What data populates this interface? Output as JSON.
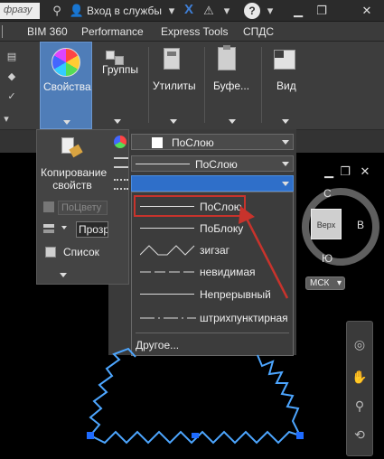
{
  "titlebar": {
    "search_text": "фразу",
    "signin_label": "Вход в службы",
    "icons": [
      "binoculars-icon",
      "user-icon",
      "x-icon",
      "triangle-icon",
      "help-icon"
    ],
    "window_buttons": [
      "minimize-icon",
      "restore-icon",
      "close-icon"
    ]
  },
  "tabs": [
    "BIM 360",
    "Performance",
    "Express Tools",
    "СПДС"
  ],
  "ribbon": {
    "properties_label": "Свойства",
    "groups_label": "Группы",
    "utilities_label": "Утилиты",
    "clipboard_label": "Буфе...",
    "view_label": "Вид"
  },
  "panel": {
    "copy_label_1": "Копирование",
    "copy_label_2": "свойств",
    "color_placeholder": "ПоЦвету",
    "transparency_value": "Прозрачн",
    "list_label": "Список",
    "color_combo_value": "ПоСлою",
    "linetype_combo_value": "ПоСлою"
  },
  "linetype_dropdown": {
    "items": [
      {
        "label": "ПоСлою",
        "style": "solid"
      },
      {
        "label": "ПоБлоку",
        "style": "solid"
      },
      {
        "label": "зигзаг",
        "style": "zigzag"
      },
      {
        "label": "невидимая",
        "style": "dashed"
      },
      {
        "label": "Непрерывный",
        "style": "solid"
      },
      {
        "label": "штрихпунктирная",
        "style": "dashdot"
      }
    ],
    "other_label": "Другое...",
    "highlighted_index": 0,
    "highlight_color": "#c8332c"
  },
  "viewcube": {
    "north": "С",
    "south": "Ю",
    "east": "В",
    "face_label": "Верх",
    "wcs_label": "МСК"
  },
  "colors": {
    "accent_blue": "#2f6fc9",
    "drawing_line": "#4da6ff",
    "grip": "#1e6bff",
    "arrow": "#c8332c"
  }
}
